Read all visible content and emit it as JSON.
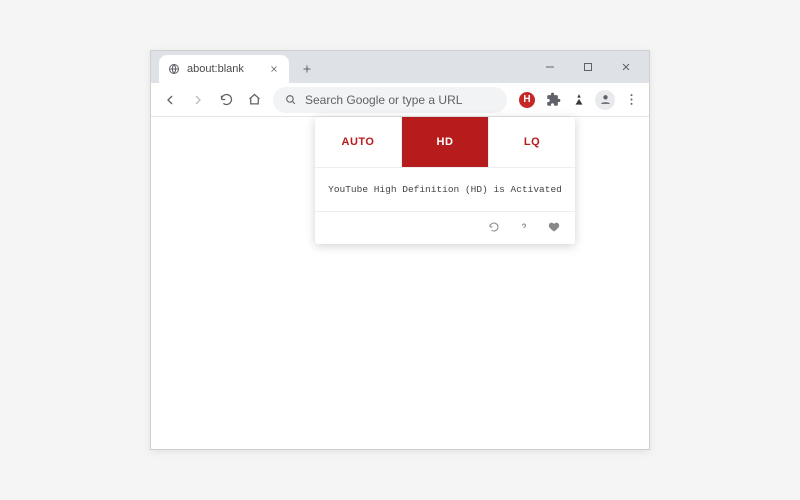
{
  "tab": {
    "title": "about:blank"
  },
  "omnibox": {
    "placeholder": "Search Google or type a URL"
  },
  "extension": {
    "badge": "H",
    "quality": {
      "auto": "AUTO",
      "hd": "HD",
      "lq": "LQ",
      "active": "hd"
    },
    "status": "YouTube High Definition (HD) is Activated"
  }
}
